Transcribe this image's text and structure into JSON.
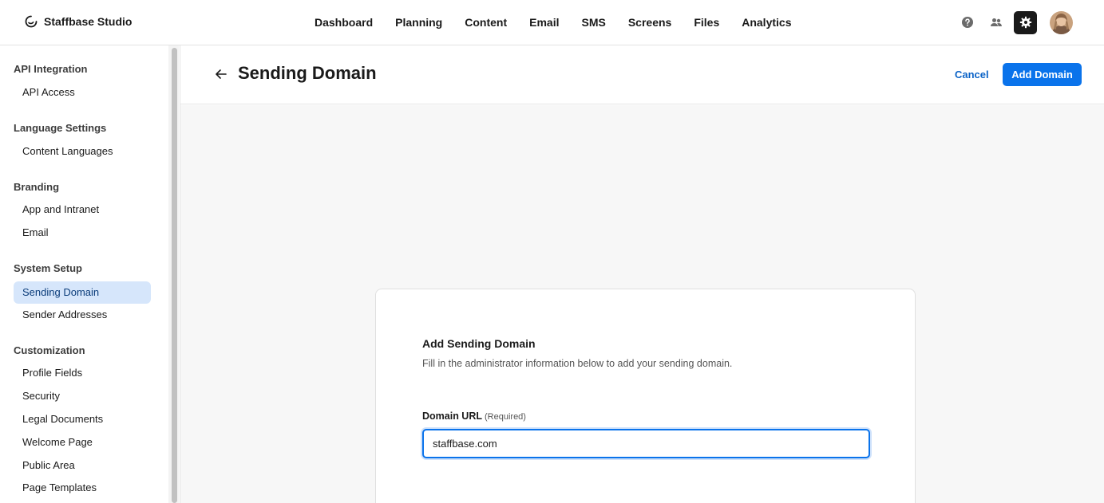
{
  "brand": {
    "name": "Staffbase Studio",
    "icon": "staffbase-logo-icon"
  },
  "nav": {
    "items": [
      "Dashboard",
      "Planning",
      "Content",
      "Email",
      "SMS",
      "Screens",
      "Files",
      "Analytics"
    ]
  },
  "top_icons": [
    "help-icon",
    "users-icon",
    "gear-icon",
    "avatar"
  ],
  "sidebar": {
    "groups": [
      {
        "title": "API Integration",
        "items": [
          "API Access"
        ]
      },
      {
        "title": "Language Settings",
        "items": [
          "Content Languages"
        ]
      },
      {
        "title": "Branding",
        "items": [
          "App and Intranet",
          "Email"
        ]
      },
      {
        "title": "System Setup",
        "items": [
          "Sending Domain",
          "Sender Addresses"
        ]
      },
      {
        "title": "Customization",
        "items": [
          "Profile Fields",
          "Security",
          "Legal Documents",
          "Welcome Page",
          "Public Area",
          "Page Templates"
        ]
      }
    ],
    "active_item": "Sending Domain"
  },
  "header": {
    "title": "Sending Domain",
    "cancel_label": "Cancel",
    "add_label": "Add Domain"
  },
  "card": {
    "title": "Add Sending Domain",
    "description": "Fill in the administrator information below to add your sending domain.",
    "field_label": "Domain URL",
    "field_required": "(Required)",
    "field_value": "staffbase.com"
  },
  "colors": {
    "accent": "#0a73eb",
    "active_bg": "#d6e6fb",
    "link": "#0b63c7"
  }
}
